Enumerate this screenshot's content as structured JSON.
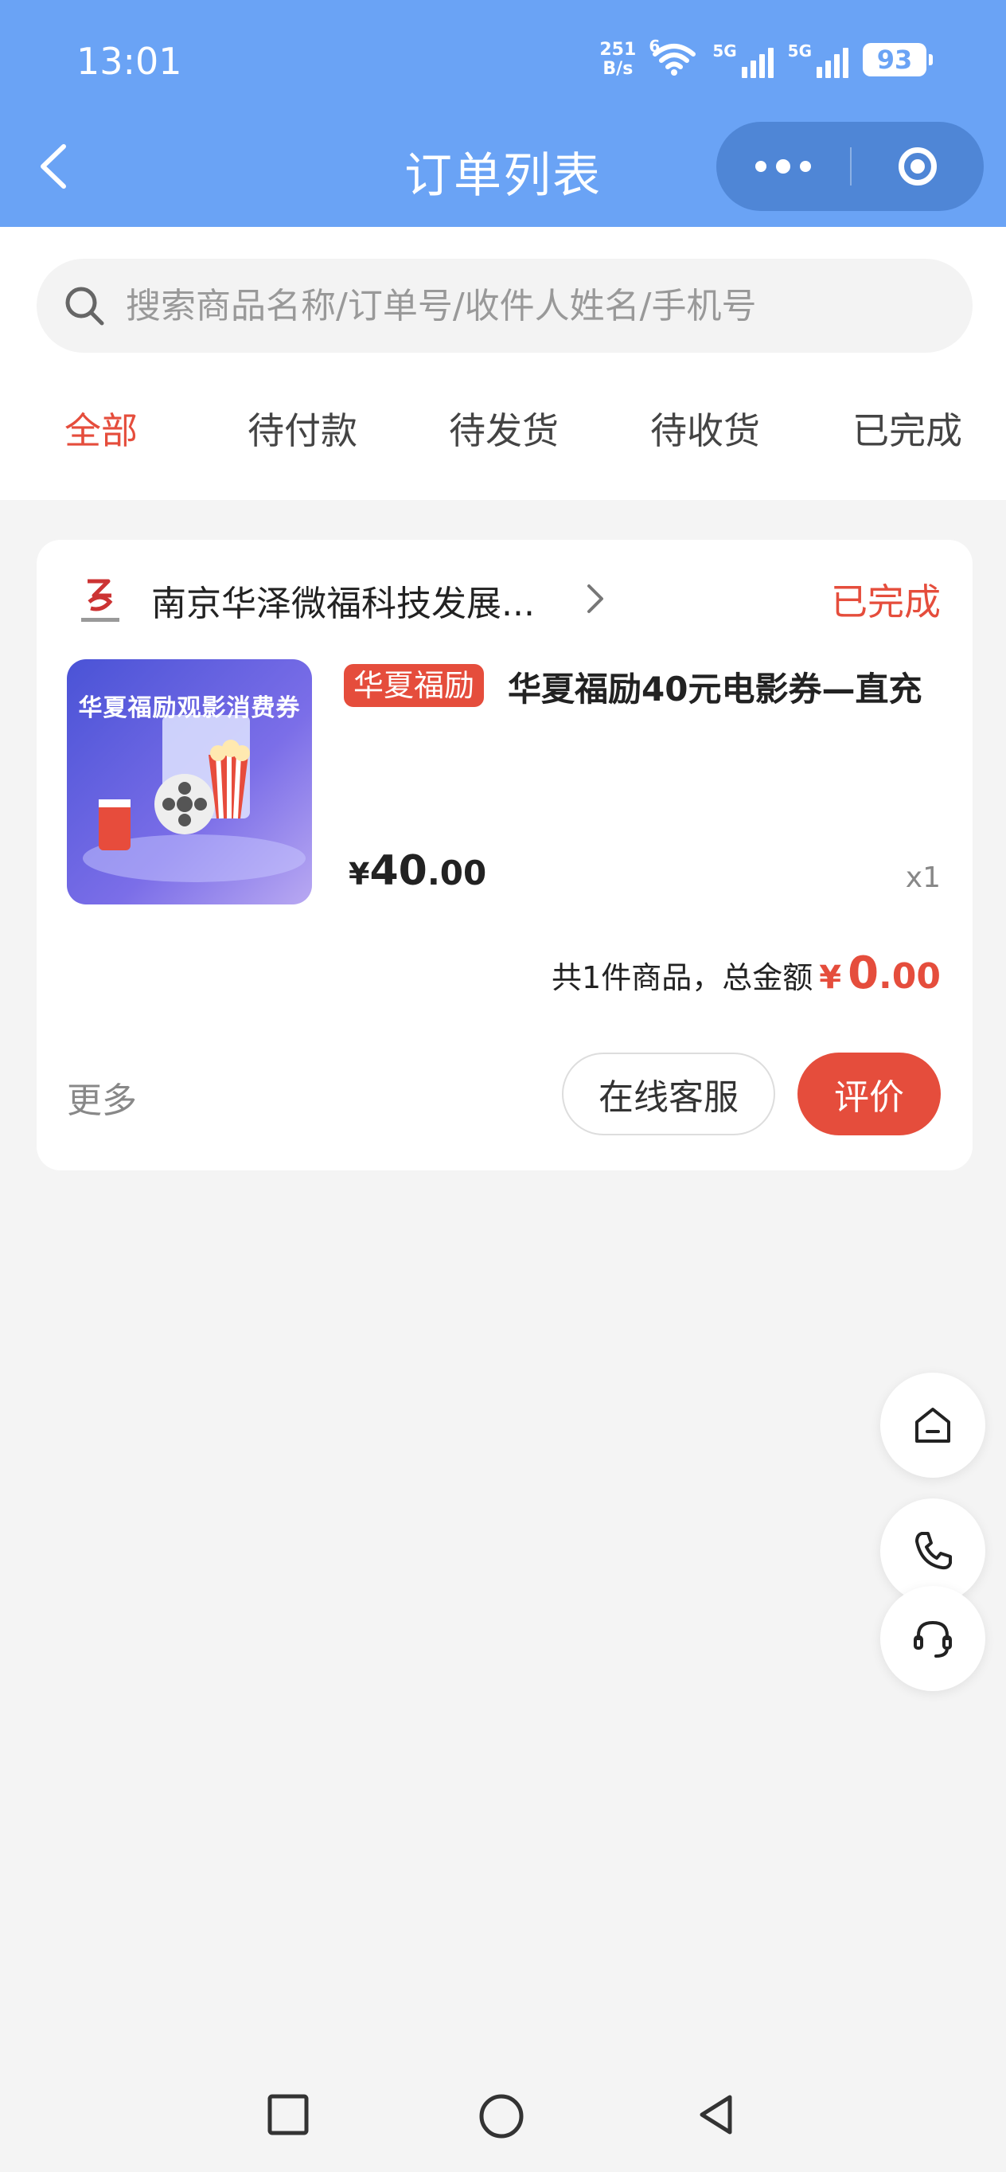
{
  "status_bar": {
    "time": "13:01",
    "net_speed_value": "251",
    "net_speed_unit": "B/s",
    "wifi_label": "6",
    "signal1_label": "5G",
    "signal2_label": "5G",
    "battery": "93"
  },
  "nav": {
    "title": "订单列表"
  },
  "search": {
    "placeholder": "搜索商品名称/订单号/收件人姓名/手机号"
  },
  "tabs": [
    {
      "label": "全部",
      "active": true
    },
    {
      "label": "待付款",
      "active": false
    },
    {
      "label": "待发货",
      "active": false
    },
    {
      "label": "待收货",
      "active": false
    },
    {
      "label": "已完成",
      "active": false
    }
  ],
  "order": {
    "shop_name": "南京华泽微福科技发展...",
    "status": "已完成",
    "thumbnail_text": "华夏福励观影消费券",
    "tag": "华夏福励",
    "product_name": "华夏福励40元电影券—直充",
    "price_currency": "¥",
    "price_int": "40",
    "price_dec": ".00",
    "quantity": "x1",
    "total_label": "共1件商品，总金额",
    "total_currency": "¥",
    "total_int": "0",
    "total_dec": ".00",
    "more_label": "更多",
    "service_button": "在线客服",
    "review_button": "评价"
  },
  "floating": [
    "home-icon",
    "phone-icon",
    "headset-icon"
  ],
  "colors": {
    "header": "#6aa3f5",
    "accent_red": "#e54d3c",
    "background": "#f4f4f4"
  }
}
